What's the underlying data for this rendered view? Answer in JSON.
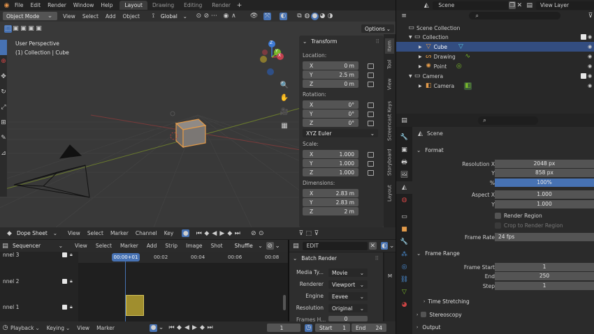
{
  "menu": {
    "file": "File",
    "edit": "Edit",
    "render": "Render",
    "window": "Window",
    "help": "Help"
  },
  "workspaces": [
    "Layout",
    "Drawing",
    "Editing",
    "Render"
  ],
  "scene_name": "Scene",
  "view_layer": "View Layer",
  "viewport_header": {
    "mode": "Object Mode",
    "view": "View",
    "select": "Select",
    "add": "Add",
    "object": "Object",
    "orientation": "Global"
  },
  "options_label": "Options",
  "viewport_info": {
    "line1": "User Perspective",
    "line2": "(1) Collection | Cube"
  },
  "gizmo": {
    "z": "Z",
    "y": "Y",
    "x": "X"
  },
  "transform": {
    "title": "Transform",
    "location_label": "Location:",
    "location": [
      {
        "axis": "X",
        "value": "0 m"
      },
      {
        "axis": "Y",
        "value": "2.5 m"
      },
      {
        "axis": "Z",
        "value": "0 m"
      }
    ],
    "rotation_label": "Rotation:",
    "rotation": [
      {
        "axis": "X",
        "value": "0°"
      },
      {
        "axis": "Y",
        "value": "0°"
      },
      {
        "axis": "Z",
        "value": "0°"
      }
    ],
    "rotation_mode": "XYZ Euler",
    "scale_label": "Scale:",
    "scale": [
      {
        "axis": "X",
        "value": "1.000"
      },
      {
        "axis": "Y",
        "value": "1.000"
      },
      {
        "axis": "Z",
        "value": "1.000"
      }
    ],
    "dimensions_label": "Dimensions:",
    "dimensions": [
      {
        "axis": "X",
        "value": "2.83 m"
      },
      {
        "axis": "Y",
        "value": "2.83 m"
      },
      {
        "axis": "Z",
        "value": "2 m"
      }
    ]
  },
  "side_tabs": [
    "Item",
    "Tool",
    "View",
    "Screencast Keys",
    "Storyboard",
    "Layout"
  ],
  "outliner": {
    "scene_collection": "Scene Collection",
    "collection": "Collection",
    "cube": "Cube",
    "drawing": "Drawing",
    "point": "Point",
    "camera_collection": "Camera",
    "camera": "Camera"
  },
  "properties": {
    "breadcrumb": "Scene",
    "format_title": "Format",
    "resolution_x_label": "Resolution X",
    "resolution_x": "2048 px",
    "resolution_y_label": "Y",
    "resolution_y": "858 px",
    "percent_label": "%",
    "percent": "100%",
    "aspect_x_label": "Aspect X",
    "aspect_x": "1.000",
    "aspect_y_label": "Y",
    "aspect_y": "1.000",
    "render_region": "Render Region",
    "crop_region": "Crop to Render Region",
    "frame_rate_label": "Frame Rate",
    "frame_rate": "24 fps",
    "frame_range_title": "Frame Range",
    "frame_start_label": "Frame Start",
    "frame_start": "1",
    "end_label": "End",
    "end": "250",
    "step_label": "Step",
    "step": "1",
    "time_stretching": "Time Stretching",
    "stereoscopy": "Stereoscopy",
    "output": "Output"
  },
  "dopesheet": {
    "mode": "Dope Sheet",
    "view": "View",
    "select": "Select",
    "marker": "Marker",
    "channel": "Channel",
    "key": "Key"
  },
  "sequencer": {
    "mode": "Sequencer",
    "view": "View",
    "select": "Select",
    "marker": "Marker",
    "add": "Add",
    "strip": "Strip",
    "image": "Image",
    "shot": "Shot",
    "shuffle": "Shuffle",
    "edit": "EDIT",
    "channels": [
      "nnel 3",
      "nnel 2",
      "nnel 1"
    ],
    "times": [
      "00:00+01",
      "00:02",
      "00:04",
      "00:06",
      "00:08"
    ]
  },
  "batch_render": {
    "title": "Batch Render",
    "media_type_label": "Media Ty...",
    "media_type": "Movie",
    "renderer_label": "Renderer",
    "renderer": "Viewport",
    "engine_label": "Engine",
    "engine": "Eevee",
    "resolution_label": "Resolution",
    "resolution": "Original",
    "frames_label": "Frames H...",
    "frames": "0"
  },
  "seq_tabs": [
    "M"
  ],
  "timeline": {
    "playback": "Playback",
    "keying": "Keying",
    "view": "View",
    "marker": "Marker",
    "current": "1",
    "start_label": "Start",
    "start": "1",
    "end_label": "End",
    "end": "24"
  },
  "colors": {
    "accent": "#4772b3",
    "cube": "#e39b4a",
    "x_axis": "#c3414e",
    "y_axis": "#79b92a",
    "z_axis": "#3e7bd6"
  }
}
